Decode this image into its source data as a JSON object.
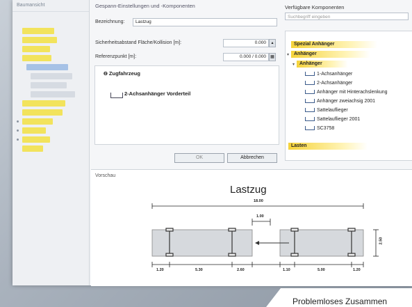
{
  "lefttree": {
    "header": "Baumansicht"
  },
  "form": {
    "section_title": "Gespann-Einstellungen und -Komponenten",
    "name_label": "Bezeichnung:",
    "name_value": "Lastzug",
    "safety_label": "Sicherheitsabstand Fläche/Kollision [m]:",
    "safety_value": "0.000",
    "ref_label": "Referenzpunkt [m]:",
    "ref_value": "0.000  /  0.000",
    "tree_items": [
      "Zugfahrzeug",
      "2-Achsanhänger Vorderteil"
    ],
    "ok_label": "OK",
    "cancel_label": "Abbrechen"
  },
  "right": {
    "title": "Verfügbare Komponenten",
    "search_placeholder": "Suchbegriff eingeben",
    "categories": [
      "Spezial Anhänger",
      "Anhänger",
      "Anhänger",
      "Lasten"
    ],
    "components": [
      "1-Achsanhänger",
      "2-Achsanhänger",
      "Anhänger mit Hinterachslenkung",
      "Anhänger zweiachsig 2001",
      "Sattelauflieger",
      "Sattelauflieger 2001",
      "SC3758"
    ]
  },
  "preview": {
    "label": "Vorschau",
    "title": "Lastzug",
    "total_length": "18.00",
    "gap": "1.00",
    "width": "2.50",
    "segments": [
      "1.20",
      "5.30",
      "2.60",
      "1.10",
      "5.00",
      "1.20"
    ]
  },
  "caption": "Problemloses Zusammen"
}
